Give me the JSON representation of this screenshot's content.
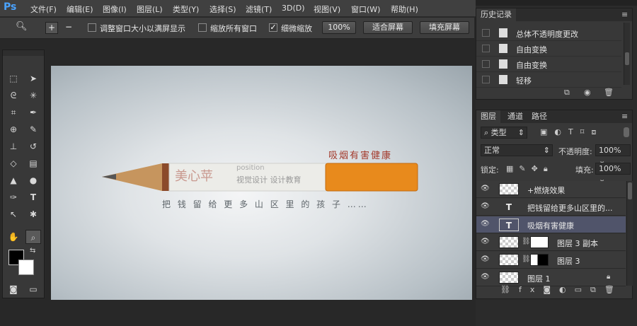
{
  "app": {
    "logo": "Ps"
  },
  "menu": [
    "文件(F)",
    "编辑(E)",
    "图像(I)",
    "图层(L)",
    "类型(Y)",
    "选择(S)",
    "滤镜(T)",
    "3D(D)",
    "视图(V)",
    "窗口(W)",
    "帮助(H)"
  ],
  "options": {
    "resize_windows": "调整窗口大小以满屏显示",
    "zoom_all": "缩放所有窗口",
    "scrubby_zoom": "细微缩放",
    "zoom_percent": "100%",
    "fit_screen": "适合屏幕",
    "fill_screen": "填充屏幕"
  },
  "document": {
    "headline": "吸烟有害健康",
    "pencil_brand": "美心苹",
    "pencil_en": "position",
    "pencil_cn": "视觉设计 设计教育",
    "tagline": "把 钱 留 给 更 多 山 区 里 的 孩 子 ……"
  },
  "history": {
    "tab": "历史记录",
    "items": [
      "总体不透明度更改",
      "自由变换",
      "自由变换",
      "轻移"
    ]
  },
  "layers": {
    "tabs": [
      "图层",
      "通道",
      "路径"
    ],
    "filter": "类型",
    "blend_mode": "正常",
    "opacity_label": "不透明度:",
    "opacity": "100%",
    "lock_label": "锁定:",
    "fill_label": "填充:",
    "fill": "100%",
    "items": [
      {
        "name": "+燃烧效果",
        "type": "pixel",
        "selected": false
      },
      {
        "name": "把钱留给更多山区里的...",
        "type": "text",
        "selected": false
      },
      {
        "name": "吸烟有害健康",
        "type": "text",
        "selected": true
      },
      {
        "name": "图层 3 副本",
        "type": "masked",
        "selected": false
      },
      {
        "name": "图层 3",
        "type": "masked",
        "selected": false
      },
      {
        "name": "图层 1",
        "type": "pixel-locked",
        "selected": false
      }
    ]
  },
  "colors": {
    "accent": "#4aa3ff",
    "headline_red": "#a33a2c",
    "cigarette_orange": "#e88a1c"
  }
}
